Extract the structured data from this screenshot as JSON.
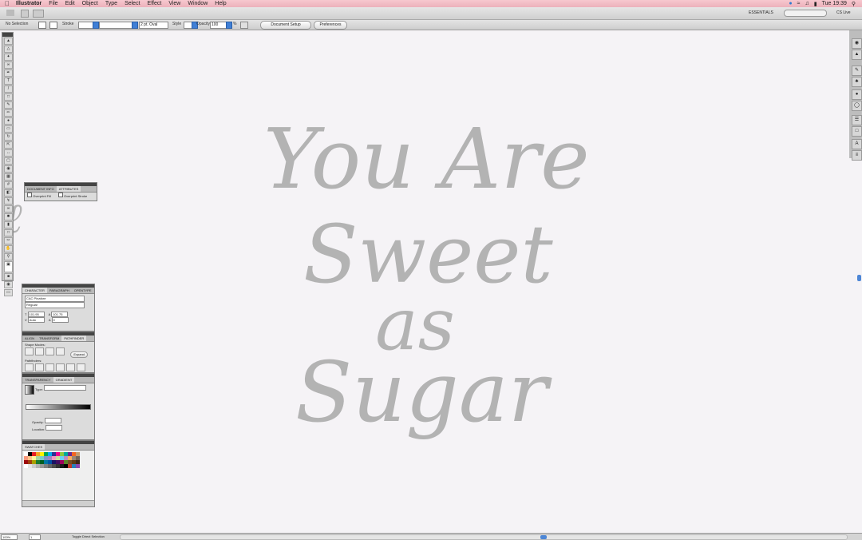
{
  "menubar": {
    "apple": "",
    "app": "Illustrator",
    "items": [
      "File",
      "Edit",
      "Object",
      "Type",
      "Select",
      "Effect",
      "View",
      "Window",
      "Help"
    ],
    "clock": "Tue 19:39"
  },
  "appbar": {
    "workspace": "ESSENTIALS",
    "cs_live": "CS Live"
  },
  "control_bar": {
    "selection": "No Selection",
    "stroke_label": "Stroke",
    "brush": "2 pt. Oval",
    "style_label": "Style",
    "opacity_label": "Opacity",
    "opacity_value": "100",
    "opacity_unit": "%",
    "document_setup": "Document Setup",
    "preferences": "Preferences"
  },
  "doc_panel": {
    "tabs": [
      "DOCUMENT INFO",
      "ATTRIBUTES"
    ],
    "overprint_fill": "Overprint Fill",
    "overprint_stroke": "Overprint Stroke"
  },
  "character_panel": {
    "tabs": [
      "CHARACTER",
      "PARAGRAPH",
      "OPENTYPE"
    ],
    "font": "CAC Pinafore",
    "style": "Regular",
    "size": "101.95",
    "leading": "101.75",
    "kerning": "Auto",
    "tracking": "0"
  },
  "pathfinder_panel": {
    "tabs": [
      "ALIGN",
      "TRANSFORM",
      "PATHFINDER"
    ],
    "shape_modes": "Shape Modes:",
    "expand": "Expand",
    "pathfinders": "Pathfinders:"
  },
  "gradient_panel": {
    "tabs": [
      "TRANSPARENCY",
      "GRADIENT"
    ],
    "type_label": "Type:",
    "opacity_label": "Opacity:",
    "location_label": "Location:"
  },
  "swatches_panel": {
    "tabs": [
      "SWATCHES"
    ],
    "colors": [
      "#ffffff",
      "#000000",
      "#e61e25",
      "#f7a01d",
      "#fff200",
      "#00a651",
      "#00aeef",
      "#2e3192",
      "#ec008c",
      "#8dc63f",
      "#00a99d",
      "#662d91",
      "#f26522",
      "#c69c6d",
      "#f7977a",
      "#fdc68a",
      "#fff79a",
      "#a3d39c",
      "#7accc8",
      "#8393ca",
      "#a187be",
      "#f49ac2",
      "#c4df9b",
      "#6dcff6",
      "#bd8cbf",
      "#fbaf5d",
      "#998675",
      "#736357",
      "#9e0b0f",
      "#a0410d",
      "#aba000",
      "#197b30",
      "#005e20",
      "#0076a3",
      "#0054a6",
      "#1b1464",
      "#440e62",
      "#9e005d",
      "#598527",
      "#754c24",
      "#603913",
      "#3c2415",
      "#ffffff",
      "#e6e6e6",
      "#cccccc",
      "#b3b3b3",
      "#999999",
      "#808080",
      "#666666",
      "#4d4d4d",
      "#333333",
      "#1a1a1a",
      "#000000",
      "#c0392b",
      "#2980b9",
      "#8e44ad"
    ]
  },
  "artwork": {
    "line1": "You Are",
    "line2": "Sweet",
    "line3": "as",
    "line4": "Sugar",
    "color": "#b3b3b3"
  },
  "statusbar": {
    "zoom": "100%",
    "page": "1",
    "tool": "Toggle Direct Selection"
  }
}
